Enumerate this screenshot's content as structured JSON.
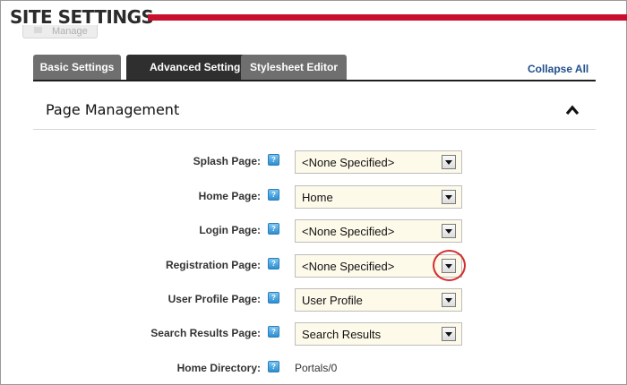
{
  "header": {
    "title": "SITE SETTINGS",
    "manage_label": "Manage",
    "accent_color": "#c8102e"
  },
  "tabs": [
    {
      "label": "Basic Settings",
      "active": false
    },
    {
      "label": "Advanced Settings",
      "active": true
    },
    {
      "label": "Stylesheet Editor",
      "active": false
    }
  ],
  "collapse_all_label": "Collapse All",
  "section": {
    "title": "Page Management",
    "toggle_icon": "chevron-up-icon"
  },
  "help_icon_glyph": "?",
  "fields": [
    {
      "label": "Splash Page:",
      "value": "<None Specified>"
    },
    {
      "label": "Home Page:",
      "value": "Home"
    },
    {
      "label": "Login Page:",
      "value": "<None Specified>"
    },
    {
      "label": "Registration Page:",
      "value": "<None Specified>",
      "highlighted": true
    },
    {
      "label": "User Profile Page:",
      "value": "User Profile"
    },
    {
      "label": "Search Results Page:",
      "value": "Search Results"
    }
  ],
  "home_directory": {
    "label": "Home Directory:",
    "value": "Portals/0"
  },
  "highlight_color": "#d42c2c"
}
